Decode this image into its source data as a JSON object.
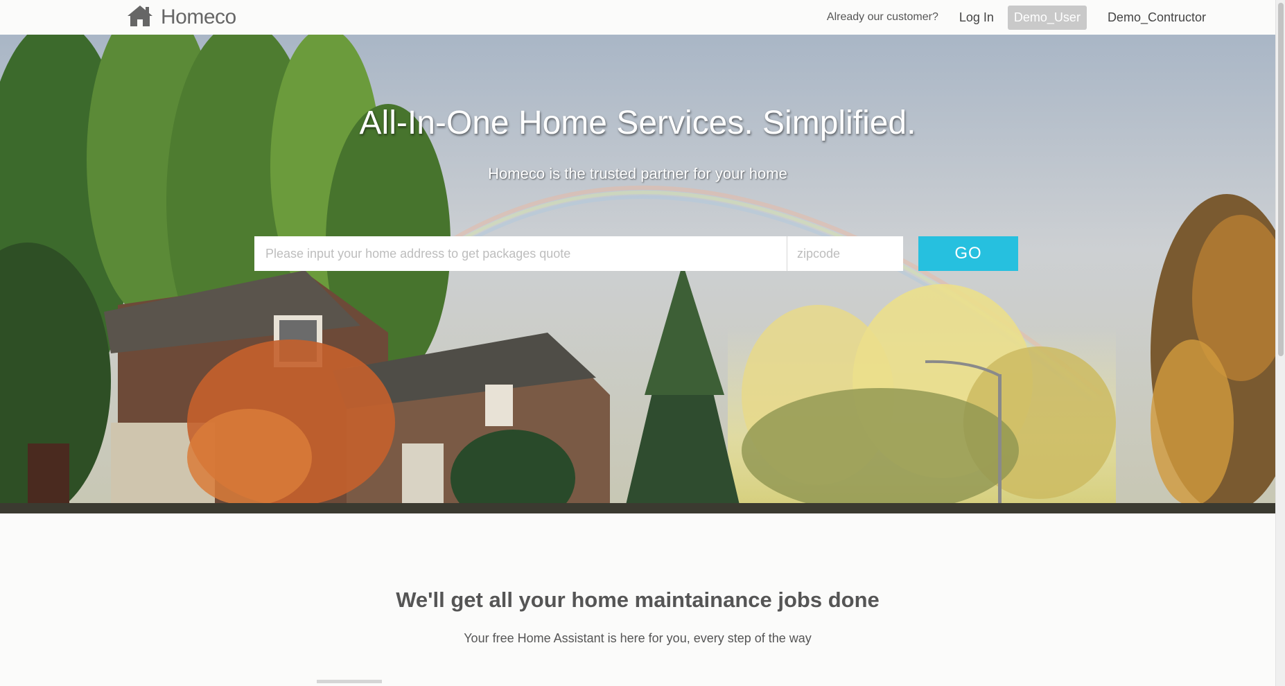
{
  "navbar": {
    "brand_name": "Homeco",
    "brand_icon": "home-icon",
    "customer_note": "Already our customer?",
    "login_label": "Log In",
    "demo_user_label": "Demo_User",
    "demo_contractor_label": "Demo_Contructor"
  },
  "hero": {
    "title": "All-In-One Home Services. Simplified.",
    "subtitle": "Homeco is the trusted partner for your home",
    "address_placeholder": "Please input your home address to get packages quote",
    "zipcode_placeholder": "zipcode",
    "go_label": "GO"
  },
  "section": {
    "title": "We'll get all your home maintainance jobs done",
    "subtitle": "Your free Home Assistant is here for you, every step of the way"
  },
  "colors": {
    "accent": "#26c0df",
    "demo_pill_bg": "#c9c9c9",
    "text_gray": "#555555"
  }
}
